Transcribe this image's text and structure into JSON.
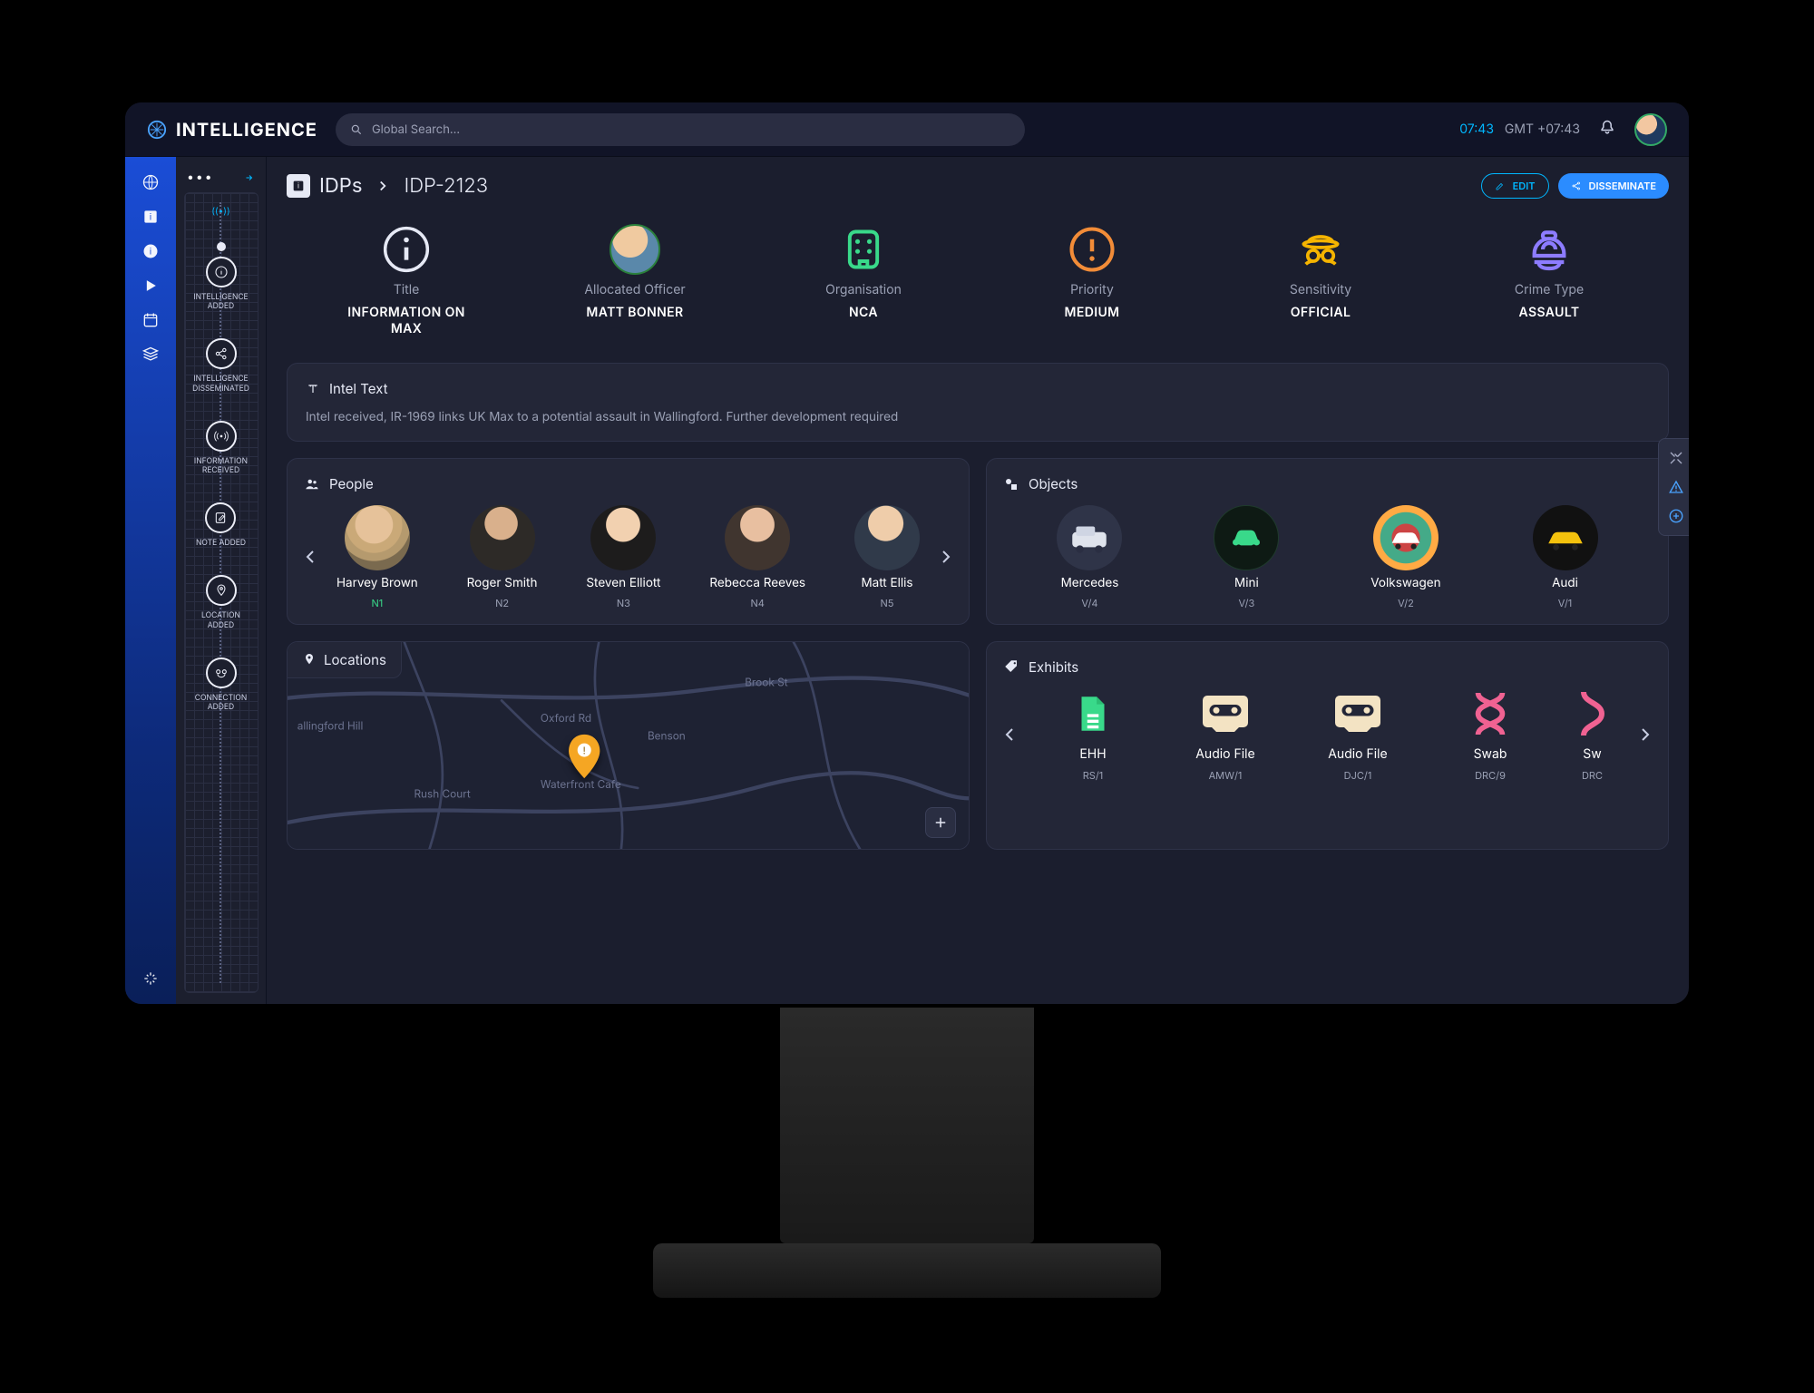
{
  "brand": "INTELLIGENCE",
  "search": {
    "placeholder": "Global Search…"
  },
  "clock": {
    "time": "07:43",
    "zone": "GMT +07:43"
  },
  "crumbs": {
    "root": "IDPs",
    "current": "IDP-2123"
  },
  "actions": {
    "edit": "EDIT",
    "disseminate": "DISSEMINATE"
  },
  "tiles": {
    "title": {
      "label": "Title",
      "value": "INFORMATION ON MAX"
    },
    "officer": {
      "label": "Allocated Officer",
      "value": "MATT BONNER"
    },
    "organisation": {
      "label": "Organisation",
      "value": "NCA"
    },
    "priority": {
      "label": "Priority",
      "value": "MEDIUM"
    },
    "sensitivity": {
      "label": "Sensitivity",
      "value": "OFFICIAL"
    },
    "crime": {
      "label": "Crime Type",
      "value": "ASSAULT"
    }
  },
  "intel": {
    "heading": "Intel Text",
    "body": "Intel received, IR-1969 links UK Max to a potential assault in Wallingford. Further development required"
  },
  "people": {
    "heading": "People",
    "items": [
      {
        "name": "Harvey Brown",
        "ref": "N1",
        "ref_style": "green"
      },
      {
        "name": "Roger Smith",
        "ref": "N2"
      },
      {
        "name": "Steven Elliott",
        "ref": "N3"
      },
      {
        "name": "Rebecca Reeves",
        "ref": "N4"
      },
      {
        "name": "Matt Ellis",
        "ref": "N5"
      }
    ]
  },
  "objects": {
    "heading": "Objects",
    "items": [
      {
        "name": "Mercedes",
        "ref": "V/4"
      },
      {
        "name": "Mini",
        "ref": "V/3",
        "highlight": true
      },
      {
        "name": "Volkswagen",
        "ref": "V/2"
      },
      {
        "name": "Audi",
        "ref": "V/1"
      }
    ]
  },
  "locations": {
    "heading": "Locations",
    "roads": [
      "allingford Hill",
      "Rush Court",
      "Oxford Rd",
      "Benson",
      "Brook St",
      "Waterfront Cafe"
    ]
  },
  "exhibits": {
    "heading": "Exhibits",
    "items": [
      {
        "name": "EHH",
        "ref": "RS/1",
        "kind": "file"
      },
      {
        "name": "Audio File",
        "ref": "AMW/1",
        "kind": "audio"
      },
      {
        "name": "Audio File",
        "ref": "DJC/1",
        "kind": "audio"
      },
      {
        "name": "Swab",
        "ref": "DRC/9",
        "kind": "dna"
      },
      {
        "name": "Sw",
        "ref": "DRC",
        "kind": "dna2"
      }
    ]
  },
  "timeline": [
    {
      "label": "INTELLIGENCE ADDED",
      "icon": "info"
    },
    {
      "label": "INTELLIGENCE DISSEMINATED",
      "icon": "share"
    },
    {
      "label": "INFORMATION RECEIVED",
      "icon": "broadcast"
    },
    {
      "label": "NOTE ADDED",
      "icon": "note"
    },
    {
      "label": "LOCATION ADDED",
      "icon": "pin"
    },
    {
      "label": "CONNECTION ADDED",
      "icon": "link"
    }
  ]
}
